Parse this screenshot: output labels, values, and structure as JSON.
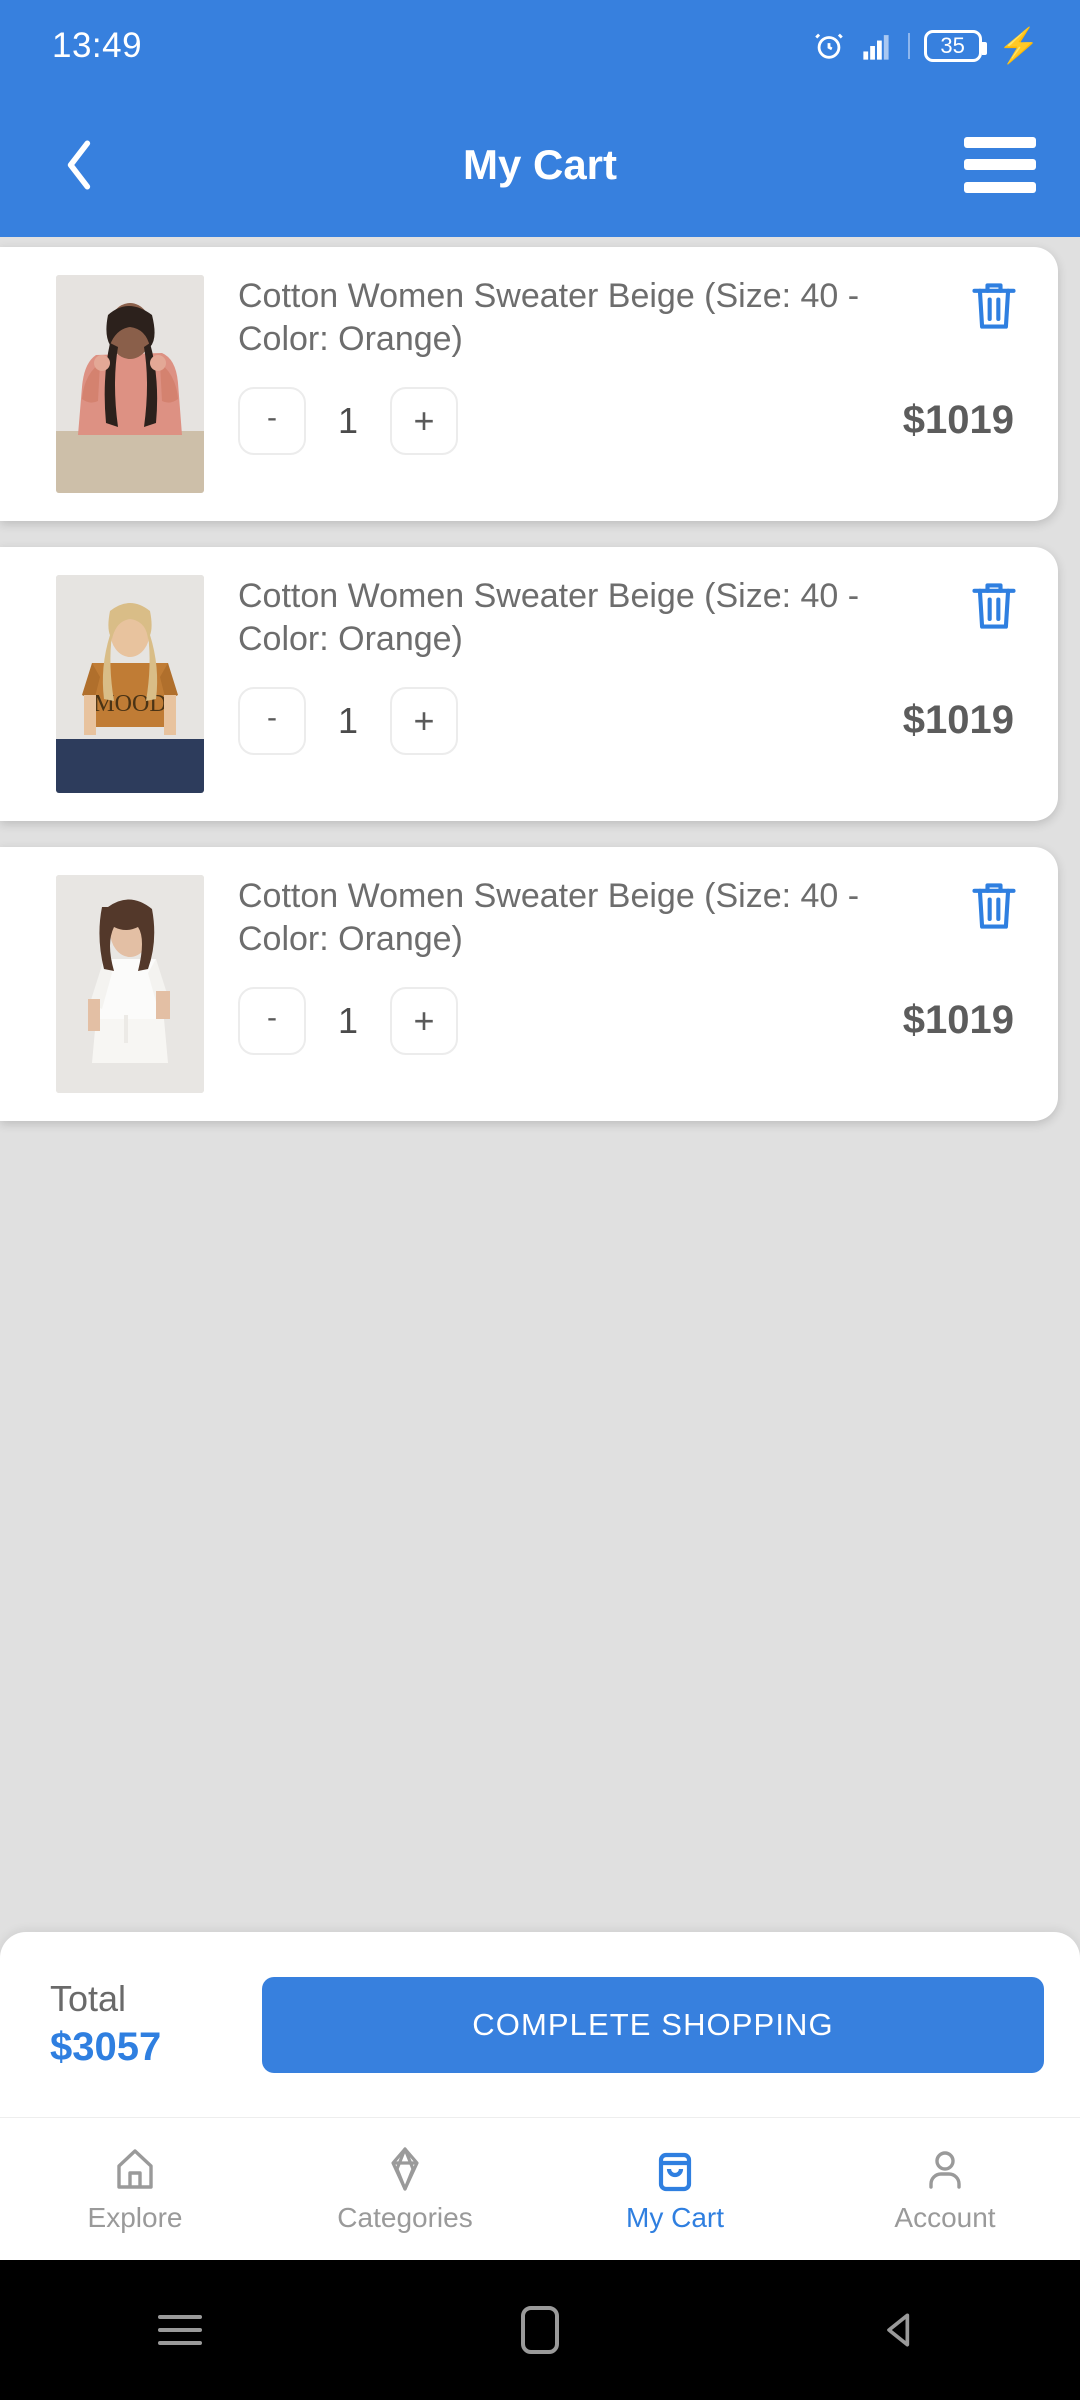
{
  "status_bar": {
    "time": "13:49",
    "battery_percent": "35",
    "icons": [
      "alarm-icon",
      "signal-icon",
      "battery-icon",
      "charging-bolt-icon"
    ]
  },
  "app_bar": {
    "title": "My Cart",
    "back_icon": "chevron-left-icon",
    "menu_icon": "hamburger-menu-icon"
  },
  "cart": {
    "items": [
      {
        "title": "Cotton Women Sweater Beige (Size: 40 - Color: Orange)",
        "quantity": "1",
        "price": "$1019",
        "decrease_label": "-",
        "increase_label": "+",
        "thumb_alt": "model-pink-ruffle-sweater"
      },
      {
        "title": "Cotton Women Sweater Beige (Size: 40 - Color: Orange)",
        "quantity": "1",
        "price": "$1019",
        "decrease_label": "-",
        "increase_label": "+",
        "thumb_alt": "model-orange-mood-tee"
      },
      {
        "title": "Cotton Women Sweater Beige (Size: 40 - Color: Orange)",
        "quantity": "1",
        "price": "$1019",
        "decrease_label": "-",
        "increase_label": "+",
        "thumb_alt": "model-white-outfit"
      }
    ]
  },
  "summary": {
    "total_label": "Total",
    "total_value": "$3057",
    "checkout_label": "COMPLETE SHOPPING"
  },
  "bottom_nav": {
    "items": [
      {
        "label": "Explore",
        "icon": "home-icon",
        "active": false
      },
      {
        "label": "Categories",
        "icon": "categories-icon",
        "active": false
      },
      {
        "label": "My Cart",
        "icon": "shopping-bag-icon",
        "active": true
      },
      {
        "label": "Account",
        "icon": "person-icon",
        "active": false
      }
    ]
  },
  "system_nav": {
    "recents_icon": "recents-icon",
    "home_icon": "home-square-icon",
    "back_icon": "back-triangle-icon"
  },
  "colors": {
    "primary": "#3780de",
    "accent": "#2f7fe0",
    "background": "#e0e0e0",
    "card": "#ffffff",
    "text_muted": "#6d6d6d",
    "charging": "#2ee36a"
  }
}
